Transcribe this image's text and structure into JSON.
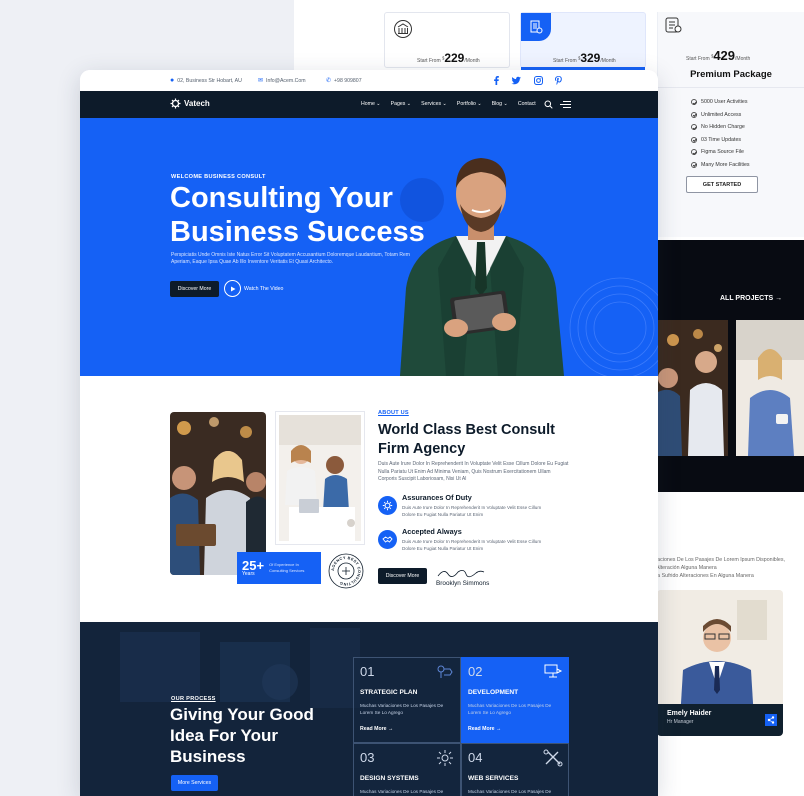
{
  "back_page": {
    "pricing": [
      {
        "prefix": "Start From",
        "currency": "$",
        "amount": "229",
        "period": "/Month"
      },
      {
        "prefix": "Start From",
        "currency": "$",
        "amount": "329",
        "period": "/Month"
      }
    ],
    "premium": {
      "prefix": "Start From",
      "currency": "$",
      "amount": "429",
      "period": "/Month",
      "title": "Premium Package",
      "features": [
        "5000 User Activities",
        "Unlimited Access",
        "No Hidden Charge",
        "03 Time Updates",
        "Figma Source File",
        "Many More Facilities"
      ],
      "cta": "GET STARTED"
    },
    "all_projects": "ALL PROJECTS",
    "text_snippet": "iaciones De Los Pasajes De Lorem Ipsum Disponibles, Alteración Alguna Manera",
    "text_snippet_2": "ia Sufrido Alteraciones En Alguna Manera",
    "team": {
      "name": "Emely Haider",
      "role": "Hr Manager"
    }
  },
  "topbar": {
    "address": "02, Business Str Hobart, AU",
    "email": "Info@Acem.Com",
    "phone": "+98 909807"
  },
  "nav": {
    "brand": "Vatech",
    "items": [
      "Home",
      "Pages",
      "Services",
      "Portfolio",
      "Blog",
      "Contact"
    ]
  },
  "hero": {
    "eyebrow": "WELCOME BUSINESS CONSULT",
    "title": "Consulting Your Business Success",
    "lead": "Perspiciatis Unde Omnis Iste Natus Error Sit Voluptatem Accusantium Doloremque Laudantium, Totam Rem Aperiam, Eaque Ipsa Quae Ab Illo Inventore Veritatis Et Quasi Architecto.",
    "primary_btn": "Discover More",
    "video_label": "Watch The Video"
  },
  "about": {
    "tag": "ABOUT US",
    "title": "World Class Best Consult Firm Agency",
    "body": "Duis Aute Irure Dolor In Reprehenderit In Voluptate Velit Esse Cillum Dolore Eu Fugiat Nulla Pariatu Ut Enim Ad Minima Veniam, Quis Nostrum Exercitationem Ullam Corporis Suscipit Laboriosam, Nisi Ut Al",
    "experience_number": "25+",
    "experience_unit": "Years",
    "experience_text": "Of Experience In Consulting Services",
    "seal_text": "AGENCY BEST CONSULTING",
    "features": [
      {
        "title": "Assurances Of Duty",
        "desc": "Duis Aute Irure Dolor In Reprehenderit In Voluptate Velit Esse Cillum Dolore Eu Fugiat Nulla Pariatur Ut Enim"
      },
      {
        "title": "Accepted Always",
        "desc": "Duis Aute Irure Dolor In Reprehenderit In Voluptate Velit Esse Cillum Dolore Eu Fugiat Nulla Pariatur Ut Enim"
      }
    ],
    "cta": "Discover More",
    "signature_name": "Brooklyn Simmons"
  },
  "process": {
    "eyebrow": "OUR PROCESS",
    "title": "Giving Your Good Idea For Your Business",
    "cta": "More Services",
    "services": [
      {
        "num": "01",
        "title": "STRATEGIC PLAN",
        "desc": "Muchas Variaciones De Los Pasajes De Lorem Se Lo Agrego",
        "link": "Read More"
      },
      {
        "num": "02",
        "title": "DEVELOPMENT",
        "desc": "Muchas Variaciones De Los Pasajes De Lorem Se Lo Agrego",
        "link": "Read More"
      },
      {
        "num": "03",
        "title": "DESIGN SYSTEMS",
        "desc": "Muchas Variaciones De Los Pasajes De",
        "link": ""
      },
      {
        "num": "04",
        "title": "WEB SERVICES",
        "desc": "Muchas Variaciones De Los Pasajes De",
        "link": ""
      }
    ]
  },
  "colors": {
    "brand_blue": "#1561f5",
    "navy": "#0d1b2a"
  }
}
